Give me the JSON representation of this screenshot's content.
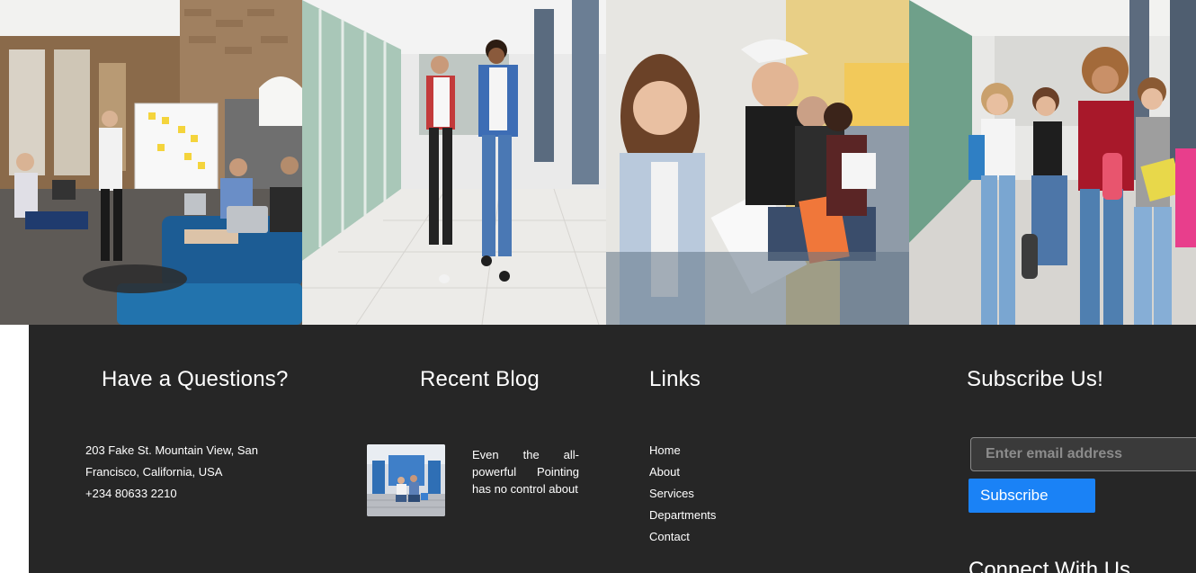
{
  "photos": [
    {
      "subject": "people-meeting-in-office"
    },
    {
      "subject": "two-students-walking-in-corridor"
    },
    {
      "subject": "students-sitting-studying-with-notebooks"
    },
    {
      "subject": "group-of-students-walking-with-books"
    }
  ],
  "footer": {
    "questions": {
      "title": "Have a Questions?",
      "address_line1": "203 Fake St. Mountain View, San",
      "address_line2": "Francisco, California, USA",
      "phone": "+234 80633 2210"
    },
    "blog": {
      "title": "Recent Blog",
      "excerpt": "Even the all-powerful Pointing has no control about"
    },
    "links": {
      "title": "Links",
      "items": [
        "Home",
        "About",
        "Services",
        "Departments",
        "Contact"
      ]
    },
    "subscribe": {
      "title": "Subscribe Us!",
      "email_placeholder": "Enter email address",
      "button_label": "Subscribe",
      "connect_title": "Connect With Us"
    }
  },
  "colors": {
    "footer_bg": "#262626",
    "accent": "#1a82f6",
    "text": "#ffffff"
  }
}
